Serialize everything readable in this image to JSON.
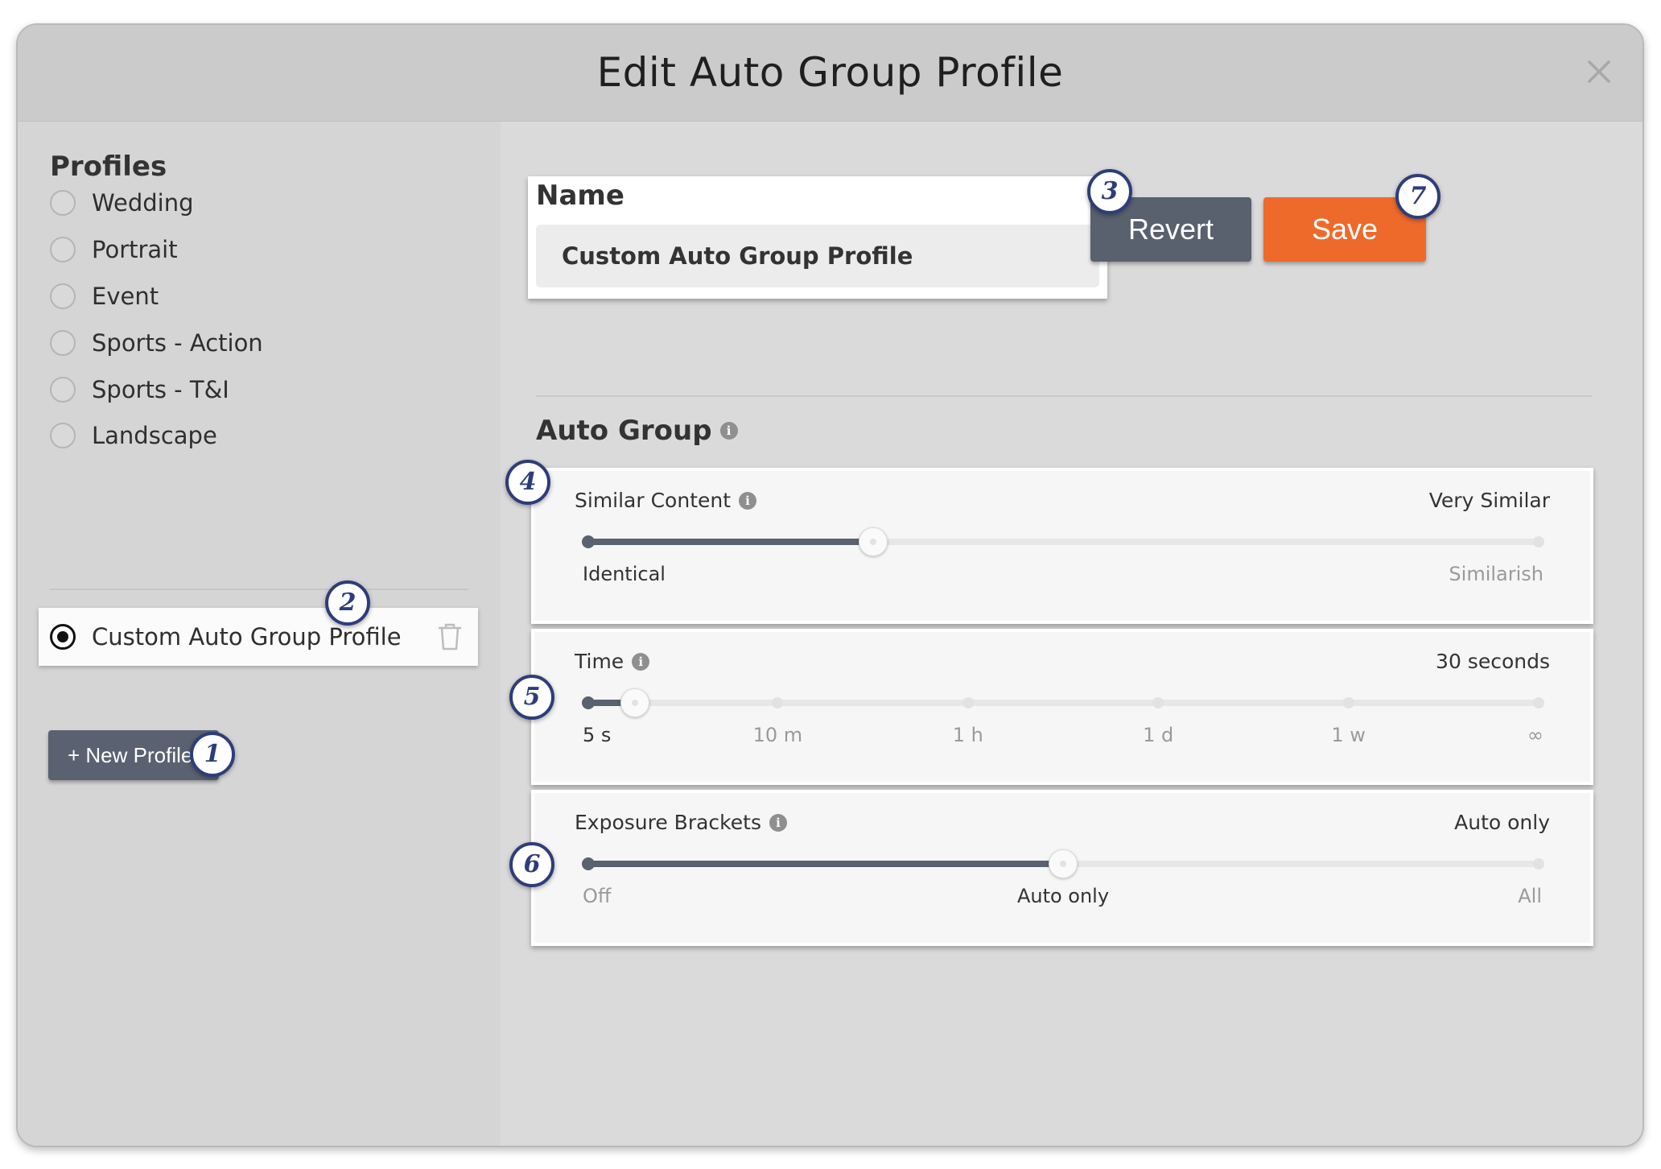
{
  "dialog": {
    "title": "Edit Auto Group Profile",
    "close_icon": "close-icon"
  },
  "sidebar": {
    "heading": "Profiles",
    "profiles": [
      {
        "label": "Wedding",
        "selected": false
      },
      {
        "label": "Portrait",
        "selected": false
      },
      {
        "label": "Event",
        "selected": false
      },
      {
        "label": "Sports - Action",
        "selected": false
      },
      {
        "label": "Sports - T&I",
        "selected": false
      },
      {
        "label": "Landscape",
        "selected": false
      }
    ],
    "custom_profile": {
      "label": "Custom Auto Group Profile",
      "selected": true,
      "icon": "trash-icon"
    },
    "new_profile_label": "+ New Profile"
  },
  "name_section": {
    "label": "Name",
    "value": "Custom Auto Group Profile"
  },
  "actions": {
    "revert_label": "Revert",
    "save_label": "Save"
  },
  "auto_group": {
    "title": "Auto Group",
    "similar_content": {
      "label": "Similar Content",
      "value": "Very Similar",
      "min_label": "Identical",
      "max_label": "Similarish",
      "fraction": 0.3
    },
    "time": {
      "label": "Time",
      "value": "30 seconds",
      "ticks": [
        "5 s",
        "10 m",
        "1 h",
        "1 d",
        "1 w",
        "∞"
      ],
      "fraction": 0.05
    },
    "exposure_brackets": {
      "label": "Exposure Brackets",
      "value": "Auto only",
      "ticks": [
        "Off",
        "Auto only",
        "All"
      ],
      "selected_index": 1
    }
  },
  "callouts": [
    "1",
    "2",
    "3",
    "4",
    "5",
    "6",
    "7"
  ],
  "colors": {
    "save": "#ee6a2b",
    "revert": "#59606e",
    "callout": "#2e3d7a",
    "slider_fill": "#5a6170"
  }
}
